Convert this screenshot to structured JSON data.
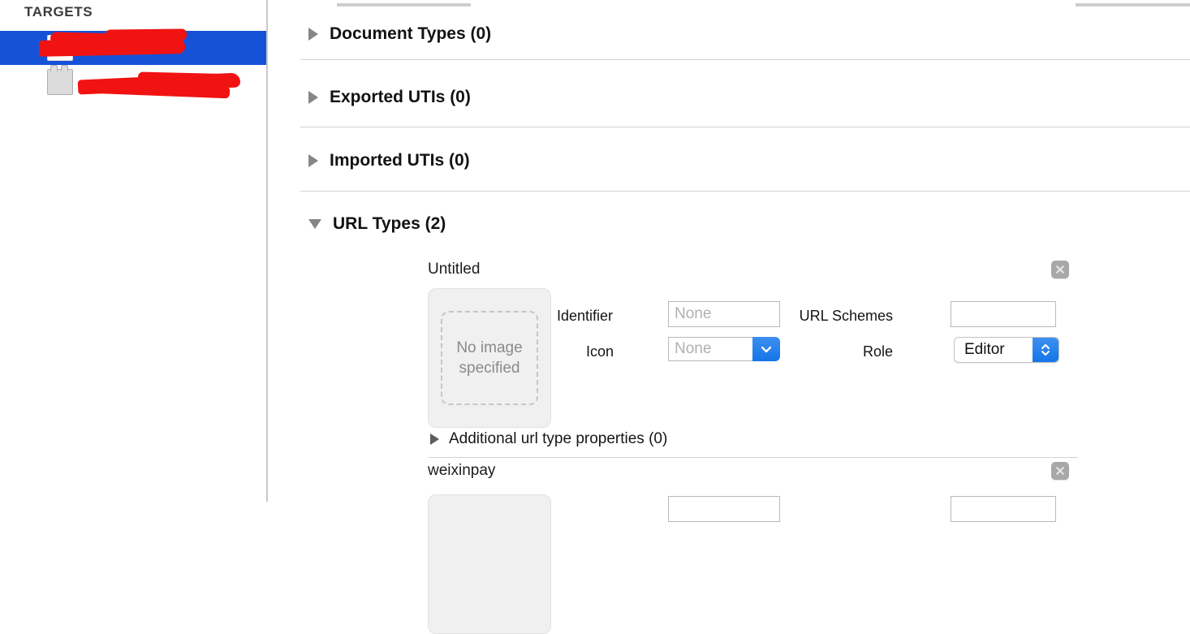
{
  "sidebar": {
    "header": "TARGETS",
    "targets": [
      {
        "label": "",
        "icon": "app-icon",
        "selected": true,
        "redacted": true
      },
      {
        "label": "",
        "icon": "extension-icon",
        "selected": false,
        "redacted": true
      }
    ]
  },
  "sections": [
    {
      "title": "Document Types (0)",
      "expanded": false
    },
    {
      "title": "Exported UTIs (0)",
      "expanded": false
    },
    {
      "title": "Imported UTIs (0)",
      "expanded": false
    },
    {
      "title": "URL Types (2)",
      "expanded": true
    }
  ],
  "url_types": {
    "entries": [
      {
        "title": "Untitled",
        "image_well_text": "No image specified",
        "identifier_label": "Identifier",
        "identifier_value": "",
        "identifier_placeholder": "None",
        "icon_label": "Icon",
        "icon_value": "",
        "icon_placeholder": "None",
        "url_schemes_label": "URL Schemes",
        "url_schemes_value": "",
        "role_label": "Role",
        "role_value": "Editor",
        "additional_properties": "Additional url type properties (0)",
        "close_label": "Remove"
      },
      {
        "title": "weixinpay",
        "close_label": "Remove"
      }
    ]
  },
  "colors": {
    "selection_blue": "#1552d8",
    "control_blue": "#1575e8",
    "redaction_red": "#f11212",
    "separator": "#d4d4d4"
  }
}
